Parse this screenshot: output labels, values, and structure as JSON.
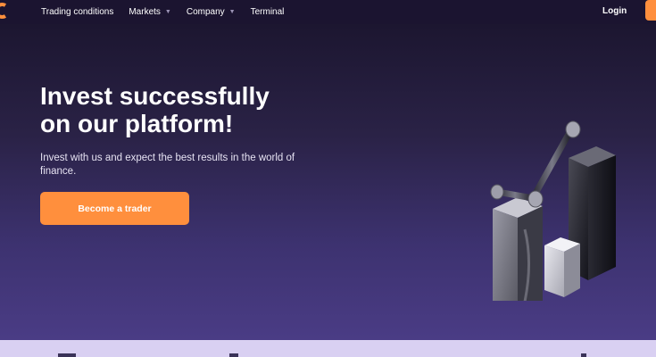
{
  "nav": {
    "items": [
      {
        "label": "Trading conditions",
        "has_dropdown": false
      },
      {
        "label": "Markets",
        "has_dropdown": true
      },
      {
        "label": "Company",
        "has_dropdown": true
      },
      {
        "label": "Terminal",
        "has_dropdown": false
      }
    ],
    "login_label": "Login"
  },
  "hero": {
    "title_line1": "Invest successfully",
    "title_line2": "on our platform!",
    "subtitle": "Invest with us and expect the best results in the world of finance.",
    "cta_label": "Become a trader"
  },
  "colors": {
    "accent": "#ff8f3d",
    "nav_bg": "#1b1430",
    "hero_top": "#1c1630",
    "hero_bottom": "#4a3c85",
    "band": "#d9d0f2"
  },
  "icons": {
    "logo": "brand-logo-icon",
    "caret": "chevron-down-icon",
    "hero_art": "bar-chart-3d-icon"
  }
}
